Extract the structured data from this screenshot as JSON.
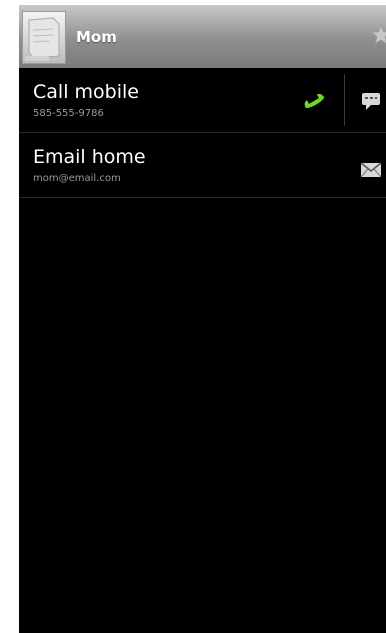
{
  "header": {
    "contact_name": "Mom"
  },
  "rows": [
    {
      "title": "Call mobile",
      "subtitle": "585-555-9786"
    },
    {
      "title": "Email home",
      "subtitle": "mom@email.com"
    }
  ],
  "icons": {
    "avatar": "contact-photo-placeholder",
    "favorite": "star-icon",
    "call": "phone-icon",
    "sms": "message-icon",
    "email": "envelope-icon"
  },
  "colors": {
    "call_accent": "#6fd62a",
    "background": "#000000",
    "header": "#8f8f8f"
  }
}
